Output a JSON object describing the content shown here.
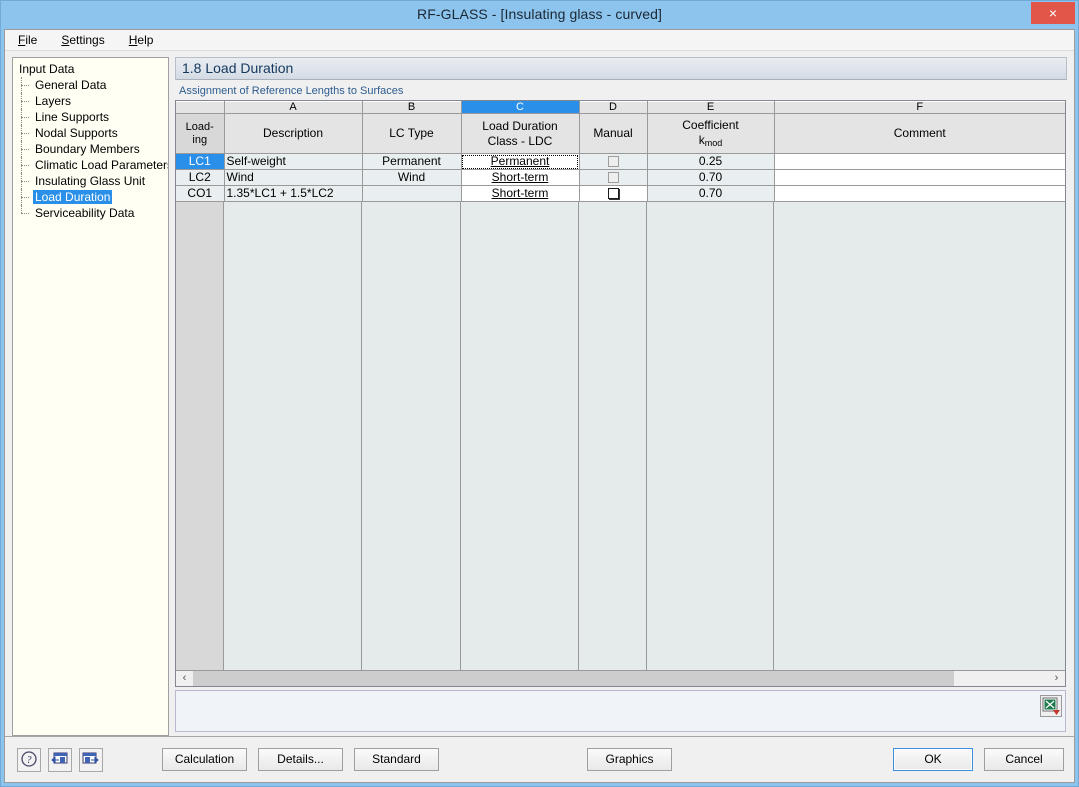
{
  "window": {
    "title": "RF-GLASS - [Insulating glass - curved]",
    "close_label": "×"
  },
  "menubar": [
    {
      "accel": "F",
      "rest": "ile"
    },
    {
      "accel": "S",
      "rest": "ettings"
    },
    {
      "accel": "H",
      "rest": "elp"
    }
  ],
  "sidebar": {
    "root": "Input Data",
    "items": [
      {
        "label": "General Data",
        "selected": false
      },
      {
        "label": "Layers",
        "selected": false
      },
      {
        "label": "Line Supports",
        "selected": false
      },
      {
        "label": "Nodal Supports",
        "selected": false
      },
      {
        "label": "Boundary Members",
        "selected": false
      },
      {
        "label": "Climatic Load Parameters",
        "selected": false
      },
      {
        "label": "Insulating Glass Unit",
        "selected": false
      },
      {
        "label": "Load Duration",
        "selected": true
      },
      {
        "label": "Serviceability Data",
        "selected": false
      }
    ]
  },
  "panel": {
    "header": "1.8 Load Duration",
    "group_caption": "Assignment of Reference Lengths to Surfaces"
  },
  "grid": {
    "column_letters": [
      "A",
      "B",
      "C",
      "D",
      "E",
      "F"
    ],
    "selected_column": "C",
    "row_header_caption": "Load-\ning",
    "headers": [
      {
        "line1": "",
        "line2": "Description"
      },
      {
        "line1": "",
        "line2": "LC Type"
      },
      {
        "line1": "Load Duration",
        "line2": "Class - LDC"
      },
      {
        "line1": "",
        "line2": "Manual"
      },
      {
        "line1": "Coefficient",
        "line2_prefix": "k",
        "line2_sub": "mod"
      },
      {
        "line1": "",
        "line2": "Comment"
      }
    ],
    "rows": [
      {
        "id": "LC1",
        "id_active": true,
        "description": "Self-weight",
        "lc_type": "Permanent",
        "ldc": "Permanent",
        "ldc_focus": true,
        "manual_enabled": false,
        "kmod": "0.25",
        "comment": ""
      },
      {
        "id": "LC2",
        "id_active": false,
        "description": "Wind",
        "lc_type": "Wind",
        "ldc": "Short-term",
        "ldc_focus": false,
        "manual_enabled": false,
        "kmod": "0.70",
        "comment": ""
      },
      {
        "id": "CO1",
        "id_active": false,
        "description": "1.35*LC1 + 1.5*LC2",
        "lc_type": "",
        "ldc": "Short-term",
        "ldc_focus": false,
        "manual_enabled": true,
        "kmod": "0.70",
        "comment": ""
      }
    ],
    "scroll_left_arrow": "‹",
    "scroll_right_arrow": "›"
  },
  "toolbar_icons": [
    {
      "name": "help-icon",
      "glyph": "?"
    },
    {
      "name": "previous-window-icon",
      "glyph": "←"
    },
    {
      "name": "next-window-icon",
      "glyph": "→"
    }
  ],
  "export": {
    "icon": "excel-export-icon"
  },
  "buttons": {
    "calculation": "Calculation",
    "details": "Details...",
    "standard": "Standard",
    "graphics": "Graphics",
    "ok": "OK",
    "cancel": "Cancel"
  },
  "colors": {
    "titlebar": "#8cc4ee",
    "accent_selection": "#2a8fe8",
    "close_button": "#e2564a",
    "grid_empty": "#e4ebea",
    "group_caption": "#2d5c8f",
    "panel_header_text": "#14385c"
  }
}
